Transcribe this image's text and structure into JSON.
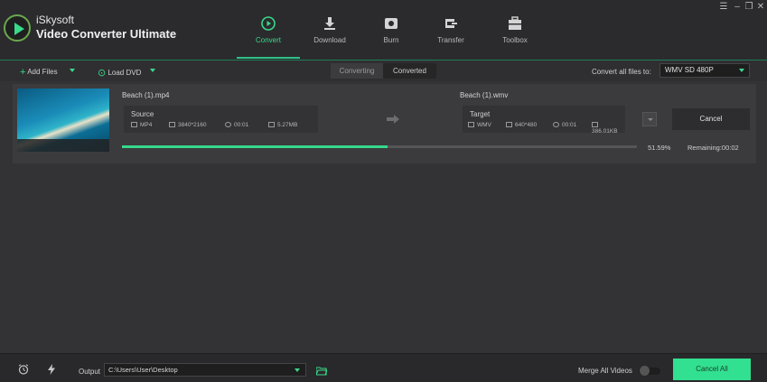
{
  "app": {
    "brand_line1": "iSkysoft",
    "brand_line2": "Video Converter Ultimate"
  },
  "nav": [
    {
      "label": "Convert",
      "icon": "convert-icon",
      "active": true
    },
    {
      "label": "Download",
      "icon": "download-icon",
      "active": false
    },
    {
      "label": "Burn",
      "icon": "burn-icon",
      "active": false
    },
    {
      "label": "Transfer",
      "icon": "transfer-icon",
      "active": false
    },
    {
      "label": "Toolbox",
      "icon": "toolbox-icon",
      "active": false
    }
  ],
  "toolbar": {
    "add_files": "Add Files",
    "load_dvd": "Load DVD",
    "seg_converting": "Converting",
    "seg_converted": "Converted",
    "convert_all_label": "Convert all files to:",
    "format_value": "WMV SD 480P"
  },
  "task": {
    "source_name": "Beach (1).mp4",
    "target_name": "Beach (1).wmv",
    "source": {
      "title": "Source",
      "format": "MP4",
      "resolution": "3840*2160",
      "duration": "00:01",
      "size": "5.27MB"
    },
    "target": {
      "title": "Target",
      "format": "WMV",
      "resolution": "640*480",
      "duration": "00:01",
      "size": "386.01KB"
    },
    "cancel_label": "Cancel",
    "progress_percent": 51.59,
    "progress_text": "51.59%",
    "remaining_text": "Remaining:00:02"
  },
  "footer": {
    "output_label": "Output",
    "output_path": "C:\\Users\\User\\Desktop",
    "merge_label": "Merge All Videos",
    "merge_on": false,
    "cancel_all_label": "Cancel All"
  },
  "colors": {
    "accent": "#35d98c",
    "background": "#333335",
    "header": "#2b2b2d"
  }
}
